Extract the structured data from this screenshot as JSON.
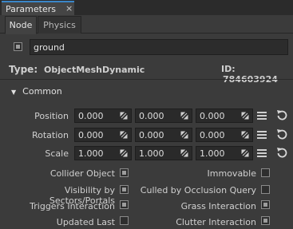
{
  "panel": {
    "title": "Parameters",
    "close_glyph": "×"
  },
  "tabs": [
    {
      "label": "Node",
      "active": true
    },
    {
      "label": "Physics",
      "active": false
    }
  ],
  "node": {
    "enabled": true,
    "name": "ground",
    "type_label": "Type:",
    "type_value": "ObjectMeshDynamic",
    "id_label": "ID:",
    "id_value": "784603924"
  },
  "section": {
    "label": "Common",
    "expanded": true
  },
  "transform": [
    {
      "label": "Position",
      "values": [
        "0.000",
        "0.000",
        "0.000"
      ]
    },
    {
      "label": "Rotation",
      "values": [
        "0.000",
        "0.000",
        "0.000"
      ]
    },
    {
      "label": "Scale",
      "values": [
        "1.000",
        "1.000",
        "1.000"
      ]
    }
  ],
  "flags": {
    "collider_object": {
      "label": "Collider Object",
      "checked": true
    },
    "immovable": {
      "label": "Immovable",
      "checked": false
    },
    "visibility_by_sectors": {
      "label": "Visibility by Sectors/Portals",
      "checked": true
    },
    "culled_by_occlusion": {
      "label": "Culled by Occlusion Query",
      "checked": false
    },
    "triggers_interaction": {
      "label": "Triggers Interaction",
      "checked": true
    },
    "grass_interaction": {
      "label": "Grass Interaction",
      "checked": true
    },
    "updated_last": {
      "label": "Updated Last",
      "checked": false
    },
    "clutter_interaction": {
      "label": "Clutter Interaction",
      "checked": true
    }
  },
  "icons": {
    "drag": "diagonal-arrows-icon",
    "menu": "hamburger-icon",
    "reset": "reset-arrow-icon",
    "collapse": "triangle-down-icon"
  },
  "colors": {
    "accent": "#3a86c8",
    "panel_bg": "#3b3b3b",
    "field_bg": "#2a2a2a"
  }
}
